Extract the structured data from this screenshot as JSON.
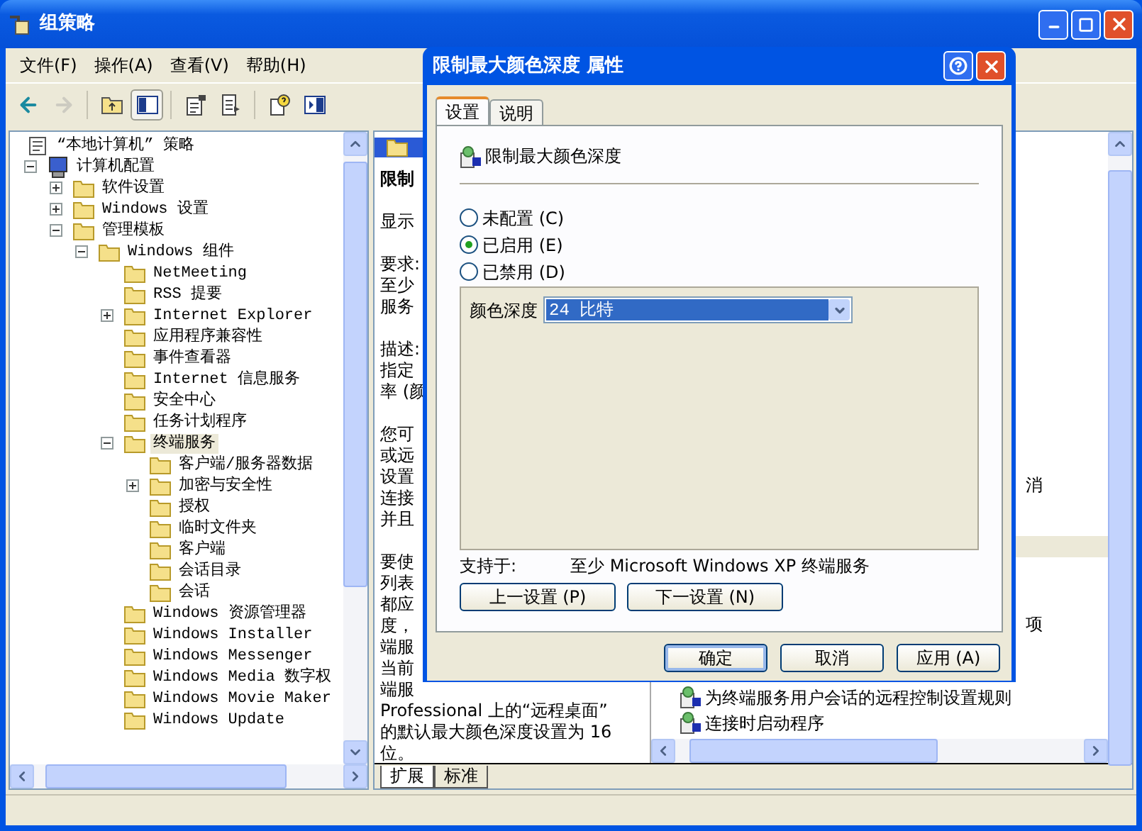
{
  "window": {
    "title": "组策略"
  },
  "menu": [
    "文件(F)",
    "操作(A)",
    "查看(V)",
    "帮助(H)"
  ],
  "toolbar": [
    {
      "kind": "back",
      "disabled": false,
      "pressed": false
    },
    {
      "kind": "forward",
      "disabled": true,
      "pressed": false
    },
    {
      "kind": "up",
      "disabled": false,
      "pressed": false
    },
    {
      "kind": "tree",
      "disabled": false,
      "pressed": true
    },
    {
      "kind": "properties",
      "disabled": false,
      "pressed": false
    },
    {
      "kind": "export",
      "disabled": false,
      "pressed": false
    },
    {
      "kind": "help",
      "disabled": false,
      "pressed": false
    },
    {
      "kind": "pane",
      "disabled": false,
      "pressed": false
    }
  ],
  "tree": {
    "label": "“本地计算机” 策略",
    "kind": "policy",
    "selected": false,
    "children": [
      {
        "label": "计算机配置",
        "kind": "computer",
        "selected": false,
        "expanded": true,
        "children": [
          {
            "label": "软件设置",
            "kind": "folder",
            "selected": false,
            "expanded": false
          },
          {
            "label": "Windows 设置",
            "kind": "folder",
            "selected": false,
            "expanded": false
          },
          {
            "label": "管理模板",
            "kind": "folder",
            "selected": false,
            "expanded": true,
            "children": [
              {
                "label": "Windows 组件",
                "kind": "folder",
                "selected": false,
                "expanded": true,
                "children": [
                  {
                    "label": "NetMeeting",
                    "kind": "folder",
                    "selected": false
                  },
                  {
                    "label": "RSS 提要",
                    "kind": "folder",
                    "selected": false
                  },
                  {
                    "label": "Internet Explorer",
                    "kind": "folder",
                    "selected": false,
                    "expanded": false
                  },
                  {
                    "label": "应用程序兼容性",
                    "kind": "folder",
                    "selected": false
                  },
                  {
                    "label": "事件查看器",
                    "kind": "folder",
                    "selected": false
                  },
                  {
                    "label": "Internet 信息服务",
                    "kind": "folder",
                    "selected": false
                  },
                  {
                    "label": "安全中心",
                    "kind": "folder",
                    "selected": false
                  },
                  {
                    "label": "任务计划程序",
                    "kind": "folder",
                    "selected": false
                  },
                  {
                    "label": "终端服务",
                    "kind": "folder",
                    "selected": true,
                    "expanded": true,
                    "children": [
                      {
                        "label": "客户端/服务器数据",
                        "kind": "folder",
                        "selected": false
                      },
                      {
                        "label": "加密与安全性",
                        "kind": "folder",
                        "selected": false,
                        "expanded": false
                      },
                      {
                        "label": "授权",
                        "kind": "folder",
                        "selected": false
                      },
                      {
                        "label": "临时文件夹",
                        "kind": "folder",
                        "selected": false
                      },
                      {
                        "label": "客户端",
                        "kind": "folder",
                        "selected": false
                      },
                      {
                        "label": "会话目录",
                        "kind": "folder",
                        "selected": false
                      },
                      {
                        "label": "会话",
                        "kind": "folder",
                        "selected": false
                      }
                    ]
                  },
                  {
                    "label": "Windows 资源管理器",
                    "kind": "folder",
                    "selected": false
                  },
                  {
                    "label": "Windows Installer",
                    "kind": "folder",
                    "selected": false
                  },
                  {
                    "label": "Windows Messenger",
                    "kind": "folder",
                    "selected": false
                  },
                  {
                    "label": "Windows Media 数字权",
                    "kind": "folder",
                    "selected": false
                  },
                  {
                    "label": "Windows Movie Maker",
                    "kind": "folder",
                    "selected": false
                  },
                  {
                    "label": "Windows Update",
                    "kind": "folder",
                    "selected": false
                  }
                ]
              }
            ]
          }
        ]
      }
    ]
  },
  "description": {
    "title": "限制",
    "paragraphs": [
      [
        "显示"
      ],
      [
        "要求:",
        "至少",
        "服务"
      ],
      [
        "描述:",
        "指定",
        "率 (颜"
      ],
      [
        "您可",
        "或远",
        "设置",
        "连接",
        "并且"
      ],
      [
        "要使",
        "列表",
        "都应",
        "度，",
        "端服",
        "当前",
        "端服",
        "Professional 上的“远程桌面”",
        "的默认最大颜色深度设置为 16",
        "位。"
      ]
    ]
  },
  "list": {
    "fragments": [
      "消",
      "项"
    ],
    "items": [
      "为终端服务用户会话的远程控制设置规则",
      "连接时启动程序"
    ]
  },
  "view_tabs": [
    {
      "label": "扩展",
      "selected": true
    },
    {
      "label": "标准",
      "selected": false
    }
  ],
  "dialog": {
    "title": "限制最大颜色深度 属性",
    "tabs": [
      {
        "label": "设置",
        "selected": true
      },
      {
        "label": "说明",
        "selected": false
      }
    ],
    "policy_name": "限制最大颜色深度",
    "options": [
      {
        "label": "未配置 (C)",
        "selected": false
      },
      {
        "label": "已启用 (E)",
        "selected": true
      },
      {
        "label": "已禁用 (D)",
        "selected": false
      }
    ],
    "setting": {
      "label": "颜色深度",
      "value": "24 比特"
    },
    "supported": {
      "label": "支持于:",
      "value": "至少 Microsoft Windows XP 终端服务"
    },
    "nav_buttons": [
      "上一设置 (P)",
      "下一设置 (N)"
    ],
    "buttons": [
      {
        "label": "确定",
        "default": true
      },
      {
        "label": "取消",
        "default": false
      },
      {
        "label": "应用 (A)",
        "default": false
      }
    ]
  }
}
